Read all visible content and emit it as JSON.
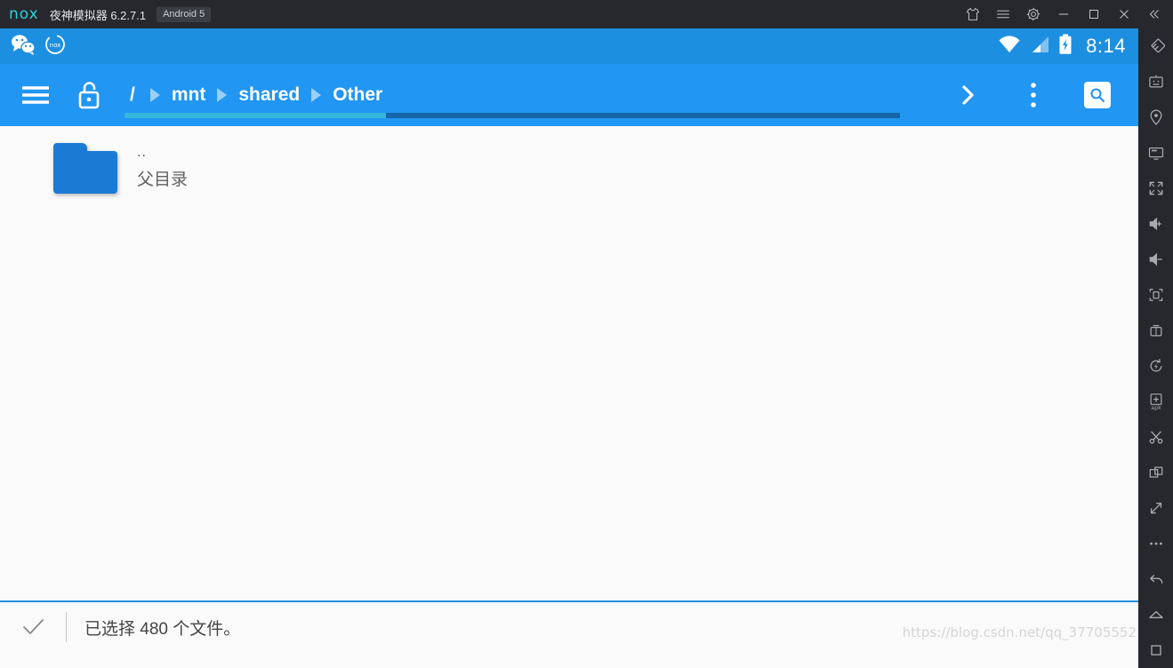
{
  "window": {
    "brand": "nox",
    "title": "夜神模拟器 6.2.7.1",
    "android_badge": "Android 5",
    "controls": [
      {
        "name": "theme-shirt",
        "label": "主题"
      },
      {
        "name": "menu",
        "label": "菜单"
      },
      {
        "name": "settings",
        "label": "设置"
      },
      {
        "name": "minimize",
        "label": "最小化"
      },
      {
        "name": "maximize",
        "label": "最大化"
      },
      {
        "name": "close",
        "label": "关闭"
      },
      {
        "name": "collapse",
        "label": "收起"
      }
    ]
  },
  "colors": {
    "titlebar_bg": "#26282d",
    "brand_cyan": "#2fd2da",
    "status_blue": "#1d8fe0",
    "appbar_blue": "#2196f3",
    "folder_blue": "#1b7ad4",
    "content_bg": "#fafafa",
    "scroll_thumb": "#35b7dc",
    "scroll_track": "#1565a8"
  },
  "android_status_bar": {
    "notifications": [
      "wechat-icon",
      "nox-icon"
    ],
    "wifi": "wifi-full",
    "signal": "signal-bars",
    "battery": "battery-charging",
    "time": "8:14"
  },
  "appbar": {
    "menu_label": "菜单",
    "lock_label": "解锁",
    "breadcrumbs": [
      "/",
      "mnt",
      "shared",
      "Other"
    ],
    "forward_label": "前进",
    "overflow_label": "更多选项",
    "search_label": "搜索",
    "scroll_position": "33%"
  },
  "files": {
    "items": [
      {
        "icon": "folder-icon",
        "name": "..",
        "subtitle": "父目录"
      }
    ]
  },
  "bottom_bar": {
    "check_icon": "check-icon",
    "status_text": "已选择 480 个文件。",
    "selected_count": "480"
  },
  "watermark": {
    "text": "https://blog.csdn.net/qq_37705552"
  },
  "sidebar": {
    "items": [
      {
        "name": "multi-instance-icon",
        "label": "多开器"
      },
      {
        "name": "keyboard-icon",
        "label": "键盘"
      },
      {
        "name": "location-icon",
        "label": "虚拟定位"
      },
      {
        "name": "display-icon",
        "label": "投屏"
      },
      {
        "name": "fullscreen-icon",
        "label": "全屏"
      },
      {
        "name": "volume-up-icon",
        "label": "音量加"
      },
      {
        "name": "volume-down-icon",
        "label": "音量减"
      },
      {
        "name": "screenshot-icon",
        "label": "截图"
      },
      {
        "name": "record-icon",
        "label": "录像"
      },
      {
        "name": "rotate-icon",
        "label": "旋转"
      },
      {
        "name": "install-apk-icon",
        "label": "安装APK"
      },
      {
        "name": "shake-icon",
        "label": "摇一摇"
      },
      {
        "name": "multi-window-icon",
        "label": "多窗口"
      },
      {
        "name": "resize-icon",
        "label": "调整大小"
      },
      {
        "name": "more-icon",
        "label": "更多"
      },
      {
        "name": "back-icon",
        "label": "返回"
      },
      {
        "name": "home-icon",
        "label": "主页"
      },
      {
        "name": "recents-icon",
        "label": "任务"
      }
    ]
  }
}
